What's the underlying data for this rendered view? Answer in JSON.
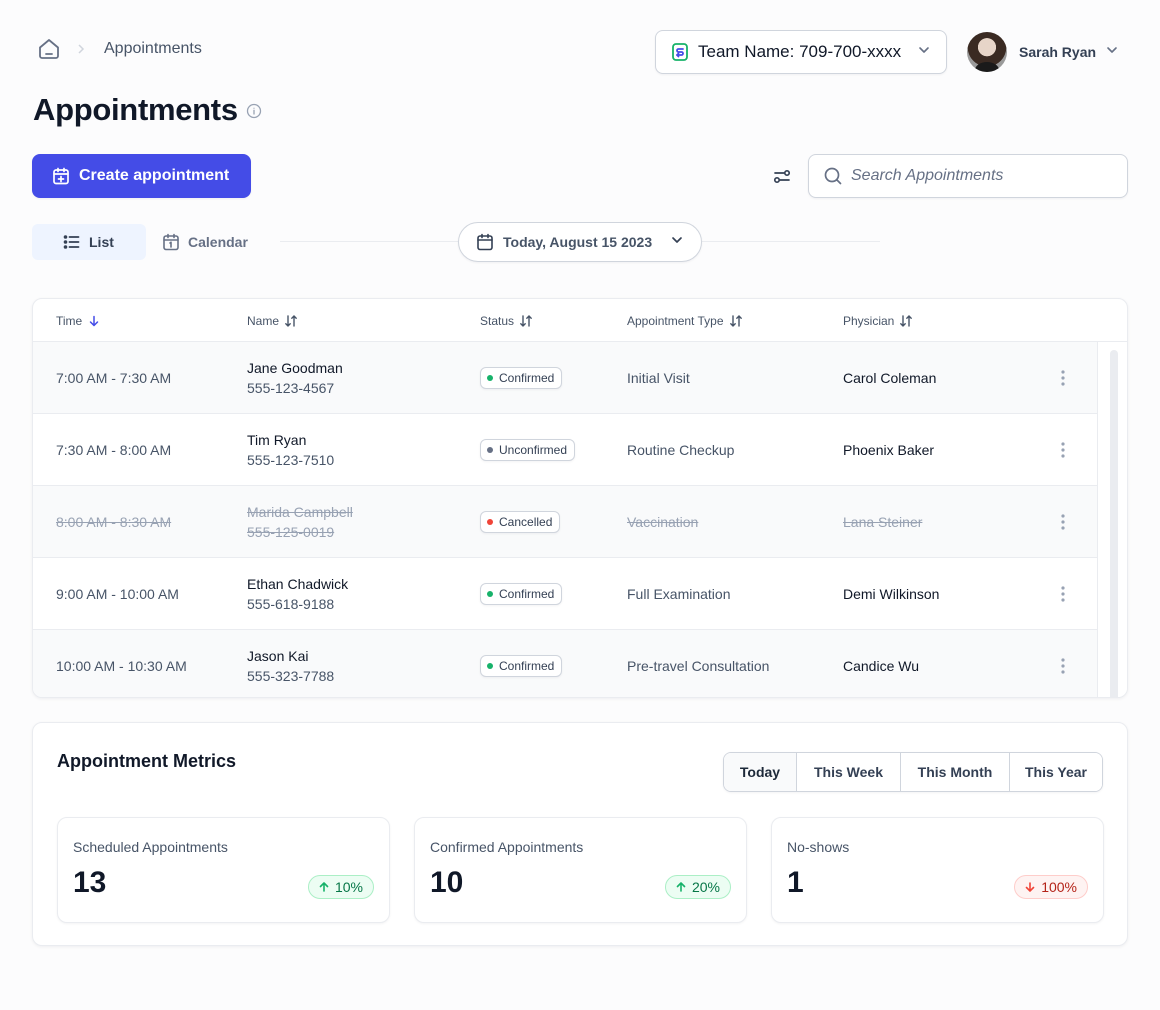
{
  "breadcrumb": {
    "home_icon": "home-icon",
    "current": "Appointments"
  },
  "team": {
    "icon": "team-switch-icon",
    "label": "Team Name: 709-700-xxxx"
  },
  "user": {
    "name": "Sarah Ryan"
  },
  "page": {
    "title": "Appointments"
  },
  "toolbar": {
    "create_label": "Create appointment",
    "search_placeholder": "Search Appointments"
  },
  "views": {
    "list_label": "List",
    "calendar_label": "Calendar",
    "active": "List"
  },
  "date_picker": {
    "label": "Today, August 15 2023"
  },
  "table": {
    "columns": [
      {
        "label": "Time",
        "sort": "desc-active"
      },
      {
        "label": "Name",
        "sort": "both"
      },
      {
        "label": "Status",
        "sort": "both"
      },
      {
        "label": "Appointment Type",
        "sort": "both"
      },
      {
        "label": "Physician",
        "sort": "both"
      }
    ],
    "rows": [
      {
        "time": "7:00 AM - 7:30 AM",
        "name": "Jane Goodman",
        "phone": "555-123-4567",
        "status": "Confirmed",
        "type": "Initial Visit",
        "physician": "Carol Coleman",
        "cancelled": false
      },
      {
        "time": "7:30 AM - 8:00 AM",
        "name": "Tim Ryan",
        "phone": "555-123-7510",
        "status": "Unconfirmed",
        "type": "Routine Checkup",
        "physician": "Phoenix Baker",
        "cancelled": false
      },
      {
        "time": "8:00 AM - 8:30 AM",
        "name": "Marida Campbell",
        "phone": "555-125-0019",
        "status": "Cancelled",
        "type": "Vaccination",
        "physician": "Lana Steiner",
        "cancelled": true
      },
      {
        "time": "9:00 AM - 10:00 AM",
        "name": "Ethan Chadwick",
        "phone": "555-618-9188",
        "status": "Confirmed",
        "type": "Full Examination",
        "physician": "Demi Wilkinson",
        "cancelled": false
      },
      {
        "time": "10:00 AM - 10:30 AM",
        "name": "Jason Kai",
        "phone": "555-323-7788",
        "status": "Confirmed",
        "type": "Pre-travel Consultation",
        "physician": "Candice Wu",
        "cancelled": false
      }
    ],
    "status_colors": {
      "Confirmed": "#17b26a",
      "Unconfirmed": "#667085",
      "Cancelled": "#f04438"
    }
  },
  "metrics": {
    "title": "Appointment Metrics",
    "ranges": [
      "Today",
      "This Week",
      "This Month",
      "This Year"
    ],
    "active_range": "Today",
    "cards": [
      {
        "label": "Scheduled Appointments",
        "value": "13",
        "trend": "10%",
        "direction": "up"
      },
      {
        "label": "Confirmed Appointments",
        "value": "10",
        "trend": "20%",
        "direction": "up"
      },
      {
        "label": "No-shows",
        "value": "1",
        "trend": "100%",
        "direction": "down"
      }
    ]
  },
  "colors": {
    "primary": "#444ce7",
    "active_tab_bg": "#eef4ff",
    "success": "#067647",
    "error": "#b42318"
  }
}
